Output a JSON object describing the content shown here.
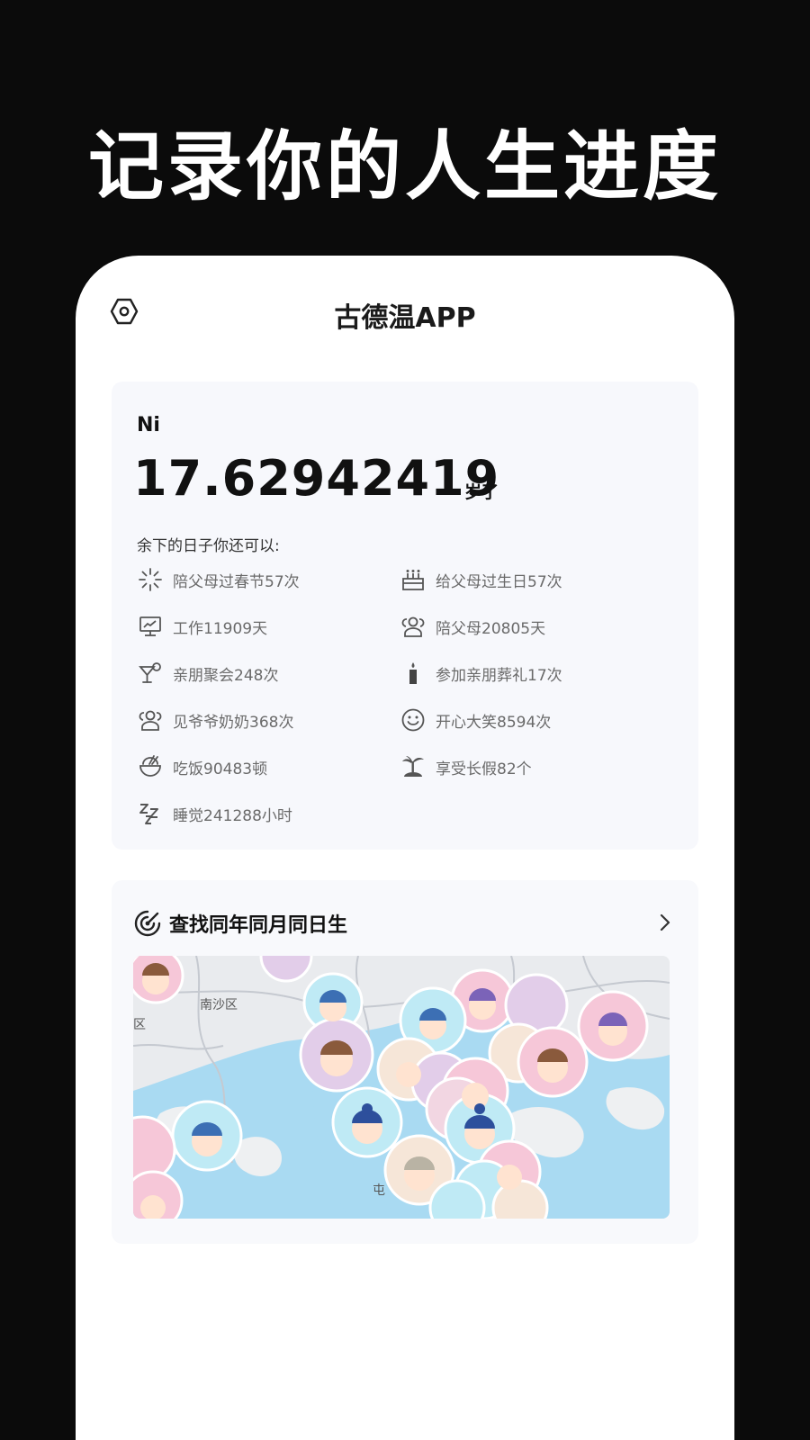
{
  "promo": {
    "title": "记录你的人生进度"
  },
  "header": {
    "app_title": "古德温APP",
    "settings_icon": "gear-hexagon-icon"
  },
  "age_card": {
    "name": "Ni",
    "age": "17.62942419",
    "age_unit": "岁了",
    "remaining_label": "余下的日子你还可以:",
    "stats": [
      {
        "icon": "fireworks-icon",
        "text": "陪父母过春节57次"
      },
      {
        "icon": "cake-icon",
        "text": "给父母过生日57次"
      },
      {
        "icon": "monitor-icon",
        "text": "工作11909天"
      },
      {
        "icon": "parents-icon",
        "text": "陪父母20805天"
      },
      {
        "icon": "cocktail-icon",
        "text": "亲朋聚会248次"
      },
      {
        "icon": "candle-icon",
        "text": "参加亲朋葬礼17次"
      },
      {
        "icon": "grandparents-icon",
        "text": "见爷爷奶奶368次"
      },
      {
        "icon": "smile-icon",
        "text": "开心大笑8594次"
      },
      {
        "icon": "bowl-icon",
        "text": "吃饭90483顿"
      },
      {
        "icon": "palm-island-icon",
        "text": "享受长假82个"
      },
      {
        "icon": "sleep-zzz-icon",
        "text": "睡觉241288小时"
      }
    ]
  },
  "peer_card": {
    "title": "查找同年同月同日生",
    "map_labels": [
      "南沙区",
      "区",
      "屯"
    ]
  },
  "colors": {
    "background": "#0b0b0b",
    "card": "#f7f8fc",
    "water": "#a9daf2",
    "avatar_pink": "#f6c7d8",
    "avatar_cyan": "#bfeaf5",
    "avatar_lilac": "#e2cde9"
  }
}
